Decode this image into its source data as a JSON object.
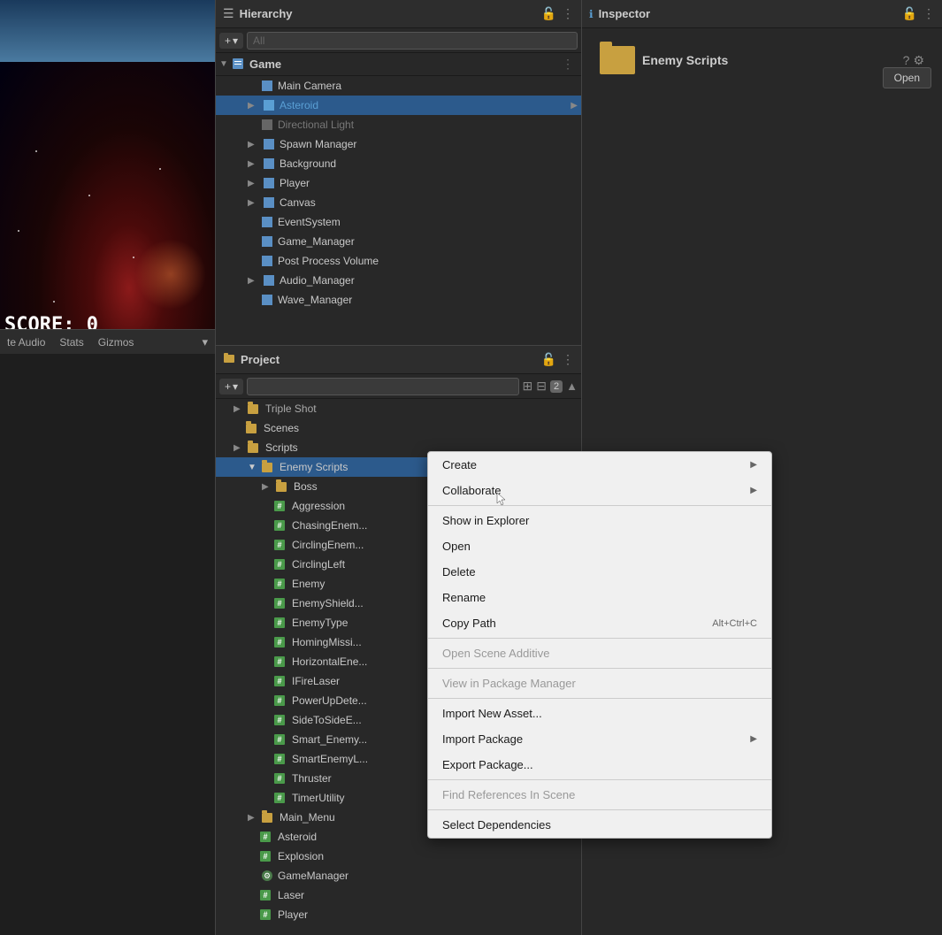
{
  "gameView": {
    "score": "SCORE: 0"
  },
  "gameTabs": {
    "tabs": [
      "te Audio",
      "Stats",
      "Gizmos"
    ],
    "dropdown": "▾"
  },
  "hierarchy": {
    "title": "Hierarchy",
    "scene": "Game",
    "items": [
      {
        "label": "Main Camera",
        "indent": 2,
        "type": "cube",
        "hasArrow": false
      },
      {
        "label": "Asteroid",
        "indent": 2,
        "type": "cube-blue",
        "hasArrow": true,
        "selected": true
      },
      {
        "label": "Directional Light",
        "indent": 2,
        "type": "cube-gray",
        "hasArrow": false,
        "gray": true
      },
      {
        "label": "Spawn Manager",
        "indent": 2,
        "type": "cube",
        "hasArrow": true
      },
      {
        "label": "Background",
        "indent": 2,
        "type": "cube",
        "hasArrow": true
      },
      {
        "label": "Player",
        "indent": 2,
        "type": "cube",
        "hasArrow": true
      },
      {
        "label": "Canvas",
        "indent": 2,
        "type": "cube",
        "hasArrow": true
      },
      {
        "label": "EventSystem",
        "indent": 2,
        "type": "cube",
        "hasArrow": false
      },
      {
        "label": "Game_Manager",
        "indent": 2,
        "type": "cube",
        "hasArrow": false
      },
      {
        "label": "Post Process Volume",
        "indent": 2,
        "type": "cube",
        "hasArrow": false
      },
      {
        "label": "Audio_Manager",
        "indent": 2,
        "type": "cube",
        "hasArrow": true
      },
      {
        "label": "Wave_Manager",
        "indent": 2,
        "type": "cube",
        "hasArrow": false
      }
    ]
  },
  "project": {
    "title": "Project",
    "searchPlaceholder": "",
    "tree": [
      {
        "label": "Triple Shot",
        "indent": 1,
        "type": "folder",
        "hasArrow": true
      },
      {
        "label": "Scenes",
        "indent": 1,
        "type": "folder",
        "hasArrow": false
      },
      {
        "label": "Scripts",
        "indent": 1,
        "type": "folder",
        "hasArrow": true
      },
      {
        "label": "Enemy Scripts",
        "indent": 2,
        "type": "folder",
        "hasArrow": true,
        "selected": true
      },
      {
        "label": "Boss",
        "indent": 3,
        "type": "folder",
        "hasArrow": true
      },
      {
        "label": "Aggression",
        "indent": 3,
        "type": "script",
        "hasArrow": false
      },
      {
        "label": "ChasingEnem...",
        "indent": 3,
        "type": "script",
        "hasArrow": false
      },
      {
        "label": "CirclingEnem...",
        "indent": 3,
        "type": "script",
        "hasArrow": false
      },
      {
        "label": "CirclingLeft",
        "indent": 3,
        "type": "script",
        "hasArrow": false
      },
      {
        "label": "Enemy",
        "indent": 3,
        "type": "script",
        "hasArrow": false
      },
      {
        "label": "EnemyShield...",
        "indent": 3,
        "type": "script",
        "hasArrow": false
      },
      {
        "label": "EnemyType",
        "indent": 3,
        "type": "script",
        "hasArrow": false
      },
      {
        "label": "HomingMissi...",
        "indent": 3,
        "type": "script",
        "hasArrow": false
      },
      {
        "label": "HorizontalEne...",
        "indent": 3,
        "type": "script",
        "hasArrow": false
      },
      {
        "label": "IFireLaser",
        "indent": 3,
        "type": "script",
        "hasArrow": false
      },
      {
        "label": "PowerUpDete...",
        "indent": 3,
        "type": "script",
        "hasArrow": false
      },
      {
        "label": "SideToSideE...",
        "indent": 3,
        "type": "script",
        "hasArrow": false
      },
      {
        "label": "Smart_Enemy...",
        "indent": 3,
        "type": "script",
        "hasArrow": false
      },
      {
        "label": "SmartEnemyL...",
        "indent": 3,
        "type": "script",
        "hasArrow": false
      },
      {
        "label": "Thruster",
        "indent": 3,
        "type": "script",
        "hasArrow": false
      },
      {
        "label": "TimerUtility",
        "indent": 3,
        "type": "script",
        "hasArrow": false
      },
      {
        "label": "Main_Menu",
        "indent": 2,
        "type": "folder",
        "hasArrow": true
      },
      {
        "label": "Asteroid",
        "indent": 2,
        "type": "script",
        "hasArrow": false
      },
      {
        "label": "Explosion",
        "indent": 2,
        "type": "script",
        "hasArrow": false
      },
      {
        "label": "GameManager",
        "indent": 2,
        "type": "gear-script",
        "hasArrow": false
      },
      {
        "label": "Laser",
        "indent": 2,
        "type": "script",
        "hasArrow": false
      },
      {
        "label": "Player",
        "indent": 2,
        "type": "script",
        "hasArrow": false
      }
    ]
  },
  "inspector": {
    "title": "Inspector",
    "folderName": "Enemy Scripts",
    "openButton": "Open"
  },
  "contextMenu": {
    "items": [
      {
        "label": "Create",
        "hasArrow": true,
        "disabled": false,
        "shortcut": ""
      },
      {
        "label": "Collaborate",
        "hasArrow": true,
        "disabled": false,
        "shortcut": ""
      },
      {
        "separator": false
      },
      {
        "label": "Show in Explorer",
        "hasArrow": false,
        "disabled": false,
        "shortcut": ""
      },
      {
        "label": "Open",
        "hasArrow": false,
        "disabled": false,
        "shortcut": ""
      },
      {
        "label": "Delete",
        "hasArrow": false,
        "disabled": false,
        "shortcut": ""
      },
      {
        "label": "Rename",
        "hasArrow": false,
        "disabled": false,
        "shortcut": ""
      },
      {
        "label": "Copy Path",
        "hasArrow": false,
        "disabled": false,
        "shortcut": "Alt+Ctrl+C"
      },
      {
        "separator1": true
      },
      {
        "label": "Open Scene Additive",
        "hasArrow": false,
        "disabled": true,
        "shortcut": ""
      },
      {
        "separator2": true
      },
      {
        "label": "View in Package Manager",
        "hasArrow": false,
        "disabled": true,
        "shortcut": ""
      },
      {
        "separator3": true
      },
      {
        "label": "Import New Asset...",
        "hasArrow": false,
        "disabled": false,
        "shortcut": ""
      },
      {
        "label": "Import Package",
        "hasArrow": true,
        "disabled": false,
        "shortcut": ""
      },
      {
        "label": "Export Package...",
        "hasArrow": false,
        "disabled": false,
        "shortcut": ""
      },
      {
        "separator4": true
      },
      {
        "label": "Find References In Scene",
        "hasArrow": false,
        "disabled": true,
        "shortcut": ""
      },
      {
        "separator5": true
      },
      {
        "label": "Select Dependencies",
        "hasArrow": false,
        "disabled": false,
        "shortcut": ""
      }
    ]
  }
}
